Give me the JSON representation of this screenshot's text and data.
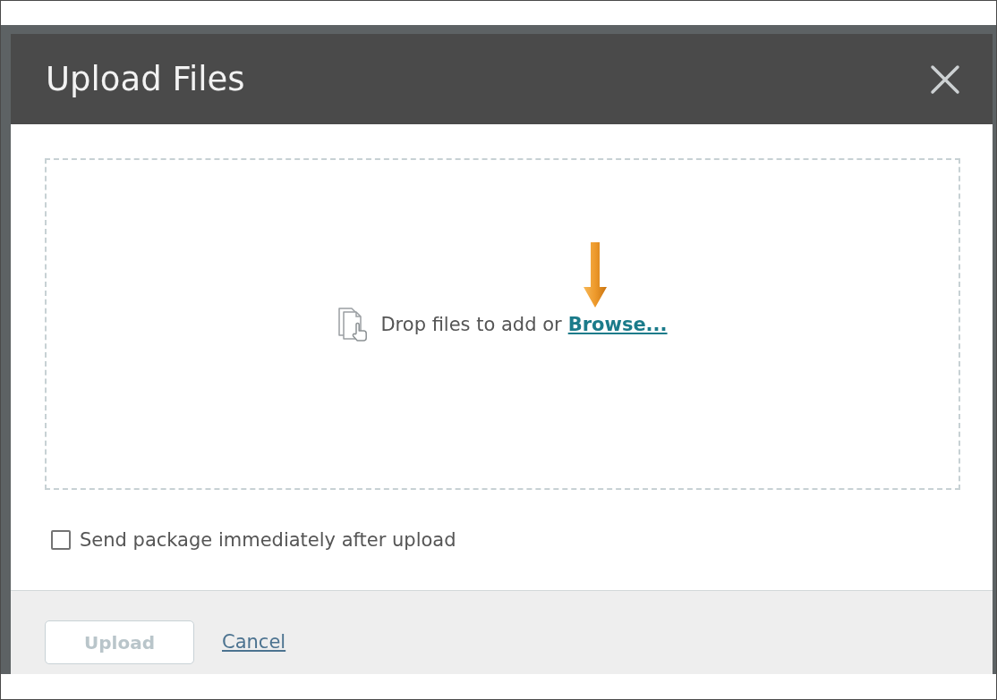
{
  "dialog": {
    "title": "Upload Files",
    "drop_zone": {
      "hint": "Drop files to add or",
      "browse_link": "Browse..."
    },
    "options": [
      {
        "kind": "checkbox",
        "label": "Send package immediately after upload",
        "checked": false
      }
    ],
    "footer_buttons": [
      {
        "kind": "button",
        "label": "Upload",
        "disabled": true
      },
      {
        "kind": "link",
        "label": "Cancel",
        "disabled": false
      }
    ]
  }
}
